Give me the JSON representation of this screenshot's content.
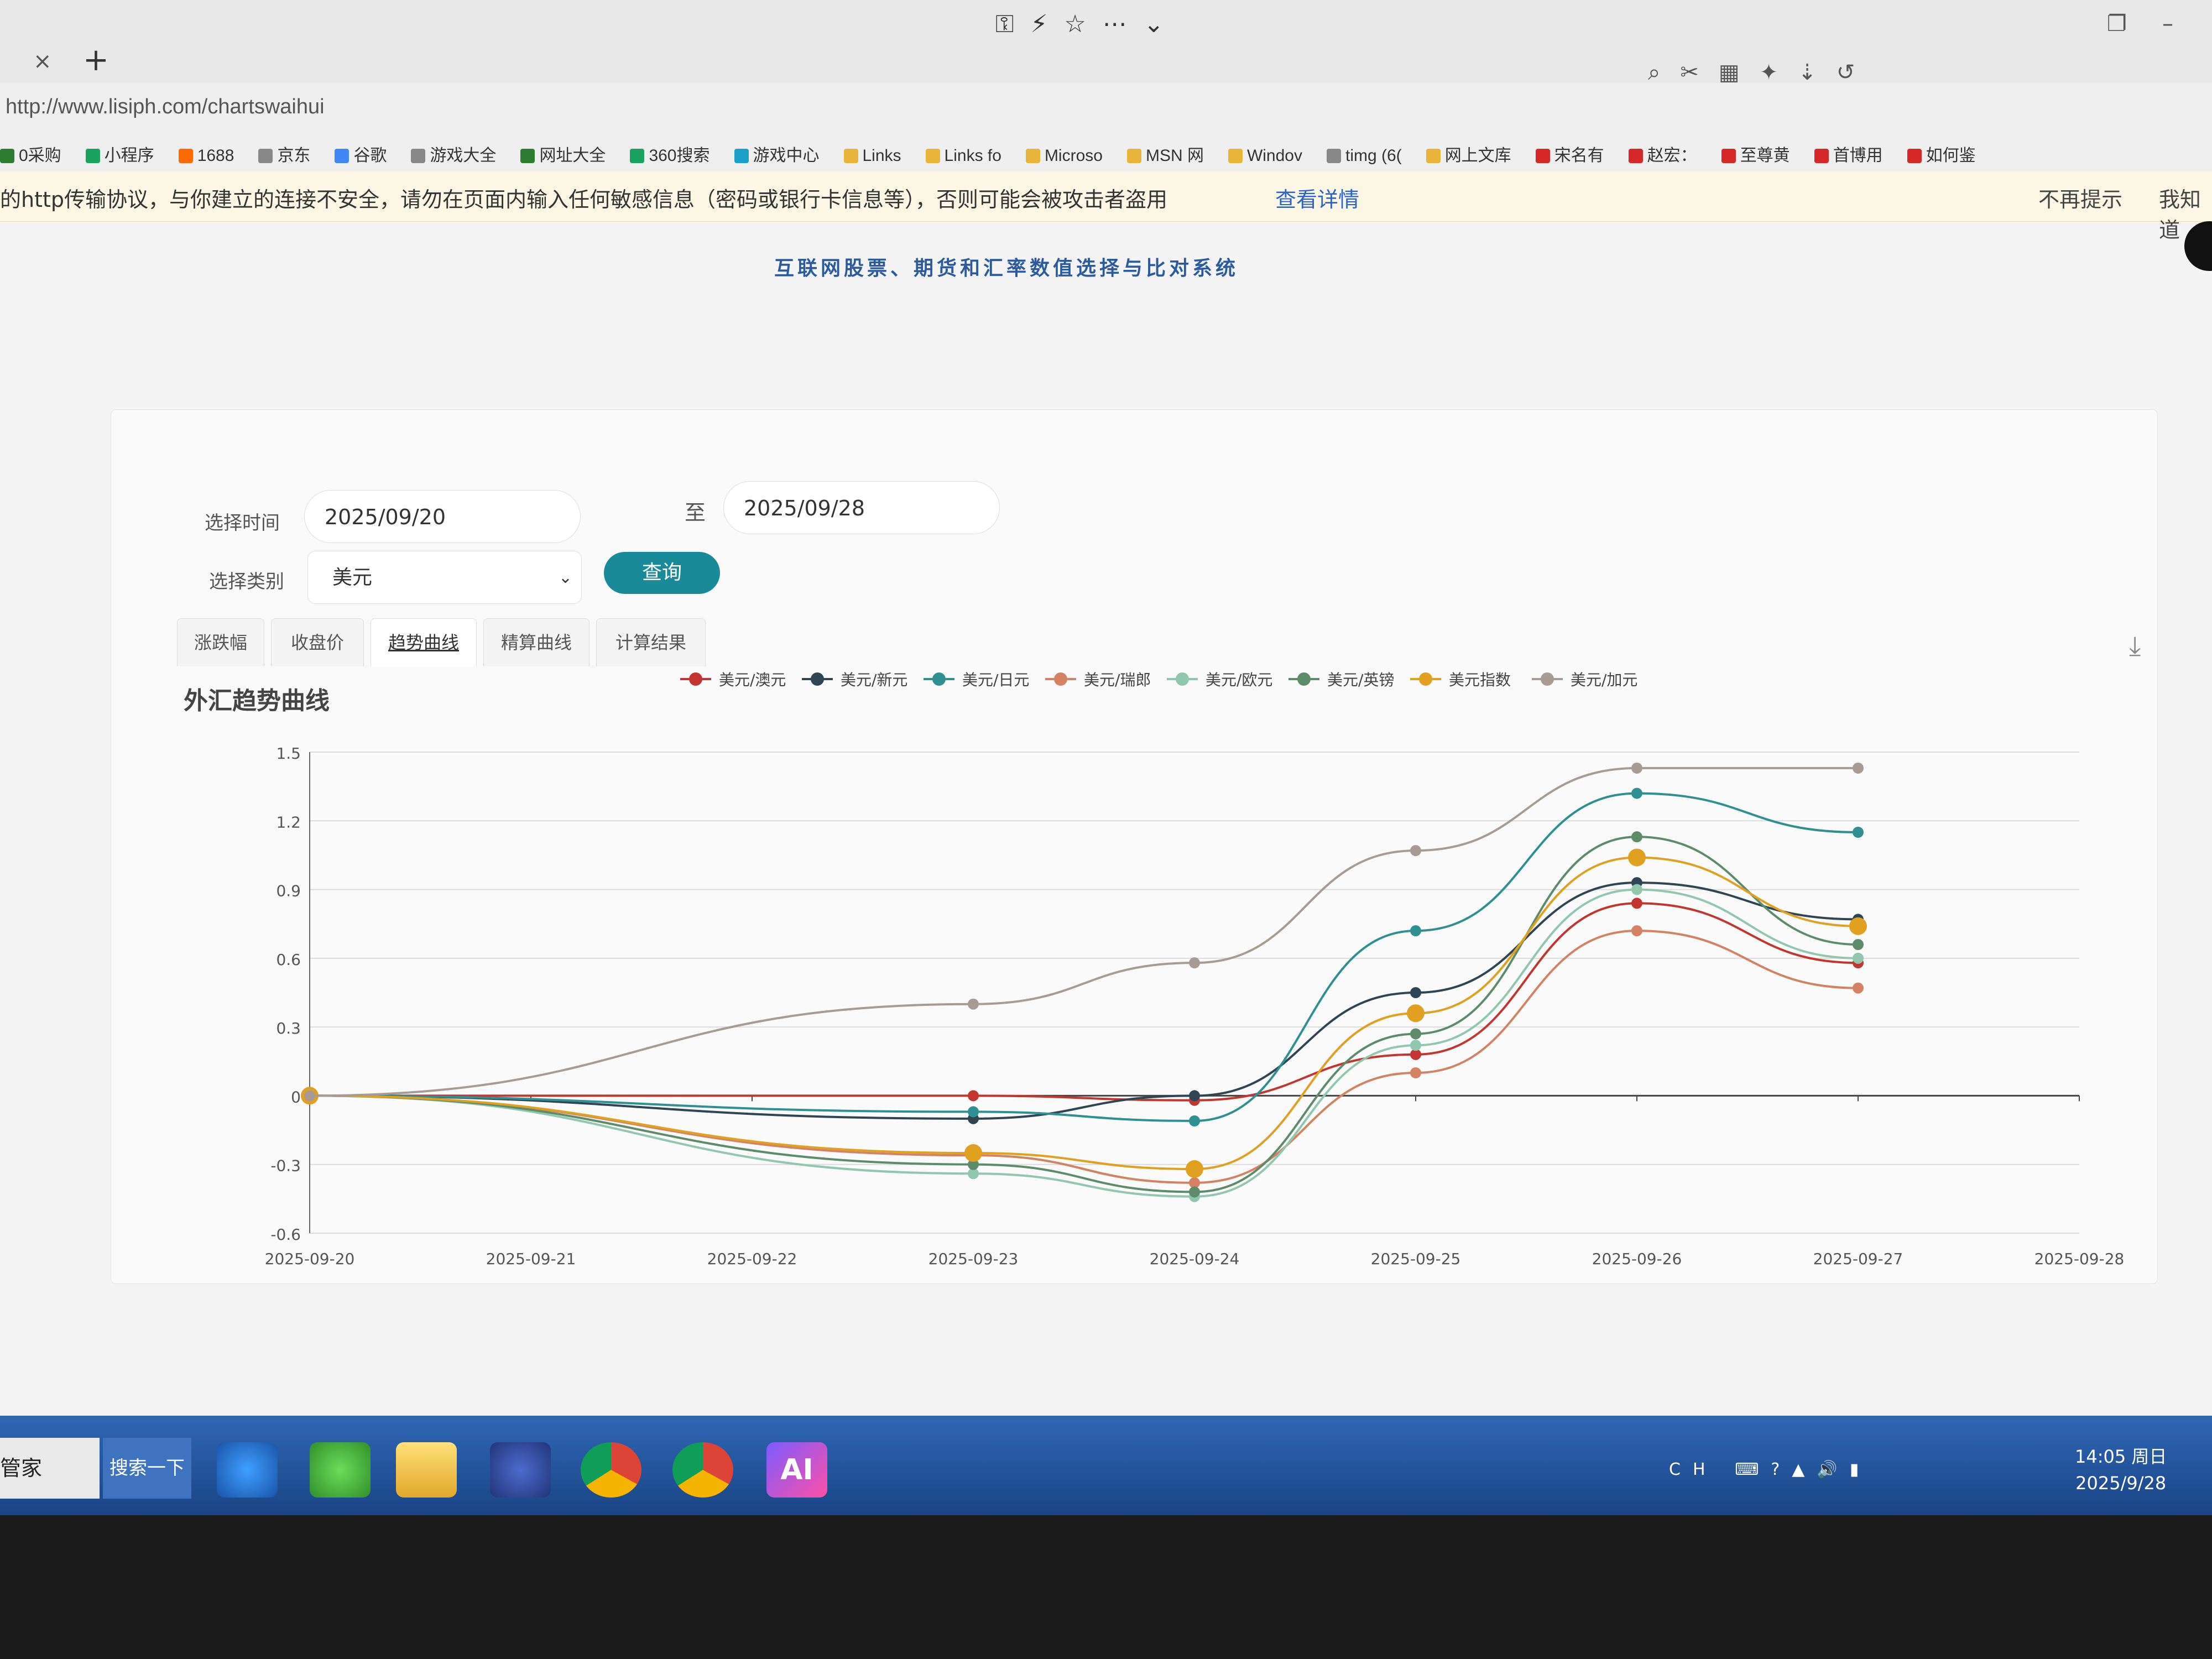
{
  "browser": {
    "tab_close": "×",
    "tab_new": "+",
    "url": "http://www.lisiph.com/chartswaihui",
    "bookmarks": [
      {
        "label": "0采购",
        "color": "#2e7d32"
      },
      {
        "label": "小程序",
        "color": "#1aa260"
      },
      {
        "label": "1688",
        "color": "#ff6a00"
      },
      {
        "label": "京东",
        "color": "#888888"
      },
      {
        "label": "谷歌",
        "color": "#4285f4"
      },
      {
        "label": "游戏大全",
        "color": "#888888"
      },
      {
        "label": "网址大全",
        "color": "#2e7d32"
      },
      {
        "label": "360搜索",
        "color": "#1aa260"
      },
      {
        "label": "游戏中心",
        "color": "#1aa0c8"
      },
      {
        "label": "Links",
        "color": "#e8b43a"
      },
      {
        "label": "Links fo",
        "color": "#e8b43a"
      },
      {
        "label": "Microso",
        "color": "#e8b43a"
      },
      {
        "label": "MSN 网",
        "color": "#e8b43a"
      },
      {
        "label": "Windov",
        "color": "#e8b43a"
      },
      {
        "label": "timg (6(",
        "color": "#888888"
      },
      {
        "label": "网上文库",
        "color": "#e8b43a"
      },
      {
        "label": "宋名有",
        "color": "#d62828"
      },
      {
        "label": "赵宏：",
        "color": "#d62828"
      },
      {
        "label": "至尊黄",
        "color": "#d62828"
      },
      {
        "label": "首博用",
        "color": "#d62828"
      },
      {
        "label": "如何鉴",
        "color": "#d62828"
      }
    ]
  },
  "warning": {
    "text": "的http传输协议，与你建立的连接不安全，请勿在页面内输入任何敏感信息（密码或银行卡信息等），否则可能会被攻击者盗用",
    "link": "查看详情",
    "dismiss": "不再提示",
    "know": "我知道"
  },
  "page": {
    "title": "互联网股票、期货和汇率数值选择与比对系统"
  },
  "form": {
    "time_label": "选择时间",
    "start_date": "2025/09/20",
    "to_label": "至",
    "end_date": "2025/09/28",
    "category_label": "选择类别",
    "category_value": "美元",
    "query_button": "查询"
  },
  "tabs": [
    {
      "label": "涨跌幅"
    },
    {
      "label": "收盘价"
    },
    {
      "label": "趋势曲线"
    },
    {
      "label": "精算曲线"
    },
    {
      "label": "计算结果"
    }
  ],
  "chart_data": {
    "type": "line",
    "title": "外汇趋势曲线",
    "x": [
      "2025-09-20",
      "2025-09-21",
      "2025-09-22",
      "2025-09-23",
      "2025-09-24",
      "2025-09-25",
      "2025-09-26",
      "2025-09-27",
      "2025-09-28"
    ],
    "ylim": [
      -0.6,
      1.5
    ],
    "yticks": [
      "1.5",
      "1.2",
      "0.9",
      "0.6",
      "0.3",
      "0",
      "-0.3",
      "-0.6"
    ],
    "legend_position": "top",
    "series": [
      {
        "name": "美元/澳元",
        "color": "#c23531",
        "x": [
          "2025-09-20",
          "2025-09-23",
          "2025-09-24",
          "2025-09-25",
          "2025-09-26",
          "2025-09-27"
        ],
        "values": [
          0,
          0,
          -0.02,
          0.18,
          0.84,
          0.58
        ]
      },
      {
        "name": "美元/新元",
        "color": "#2f4554",
        "x": [
          "2025-09-20",
          "2025-09-23",
          "2025-09-24",
          "2025-09-25",
          "2025-09-26",
          "2025-09-27"
        ],
        "values": [
          0,
          -0.1,
          0.0,
          0.45,
          0.93,
          0.77
        ]
      },
      {
        "name": "美元/日元",
        "color": "#2f8f91",
        "x": [
          "2025-09-20",
          "2025-09-23",
          "2025-09-24",
          "2025-09-25",
          "2025-09-26",
          "2025-09-27"
        ],
        "values": [
          0,
          -0.07,
          -0.11,
          0.72,
          1.32,
          1.15
        ]
      },
      {
        "name": "美元/瑞郎",
        "color": "#d48265",
        "x": [
          "2025-09-20",
          "2025-09-23",
          "2025-09-24",
          "2025-09-25",
          "2025-09-26",
          "2025-09-27"
        ],
        "values": [
          0,
          -0.26,
          -0.38,
          0.1,
          0.72,
          0.47
        ]
      },
      {
        "name": "美元/欧元",
        "color": "#91c7ae",
        "x": [
          "2025-09-20",
          "2025-09-23",
          "2025-09-24",
          "2025-09-25",
          "2025-09-26",
          "2025-09-27"
        ],
        "values": [
          0,
          -0.34,
          -0.44,
          0.22,
          0.9,
          0.6
        ]
      },
      {
        "name": "美元/英镑",
        "color": "#5e8c6a",
        "x": [
          "2025-09-20",
          "2025-09-23",
          "2025-09-24",
          "2025-09-25",
          "2025-09-26",
          "2025-09-27"
        ],
        "values": [
          0,
          -0.3,
          -0.42,
          0.27,
          1.13,
          0.66
        ]
      },
      {
        "name": "美元指数",
        "color": "#e0a020",
        "x": [
          "2025-09-20",
          "2025-09-23",
          "2025-09-24",
          "2025-09-25",
          "2025-09-26",
          "2025-09-27"
        ],
        "values": [
          0,
          -0.25,
          -0.32,
          0.36,
          1.04,
          0.74
        ]
      },
      {
        "name": "美元/加元",
        "color": "#a89b94",
        "x": [
          "2025-09-20",
          "2025-09-23",
          "2025-09-24",
          "2025-09-25",
          "2025-09-26",
          "2025-09-27"
        ],
        "values": [
          0,
          0.4,
          0.58,
          1.07,
          1.43,
          1.43
        ]
      }
    ]
  },
  "taskbar": {
    "left_label": "管家",
    "search_label": "搜索一下",
    "ai_label": "AI",
    "tray": "CH",
    "time": "14:05 周日",
    "date": "2025/9/28"
  }
}
